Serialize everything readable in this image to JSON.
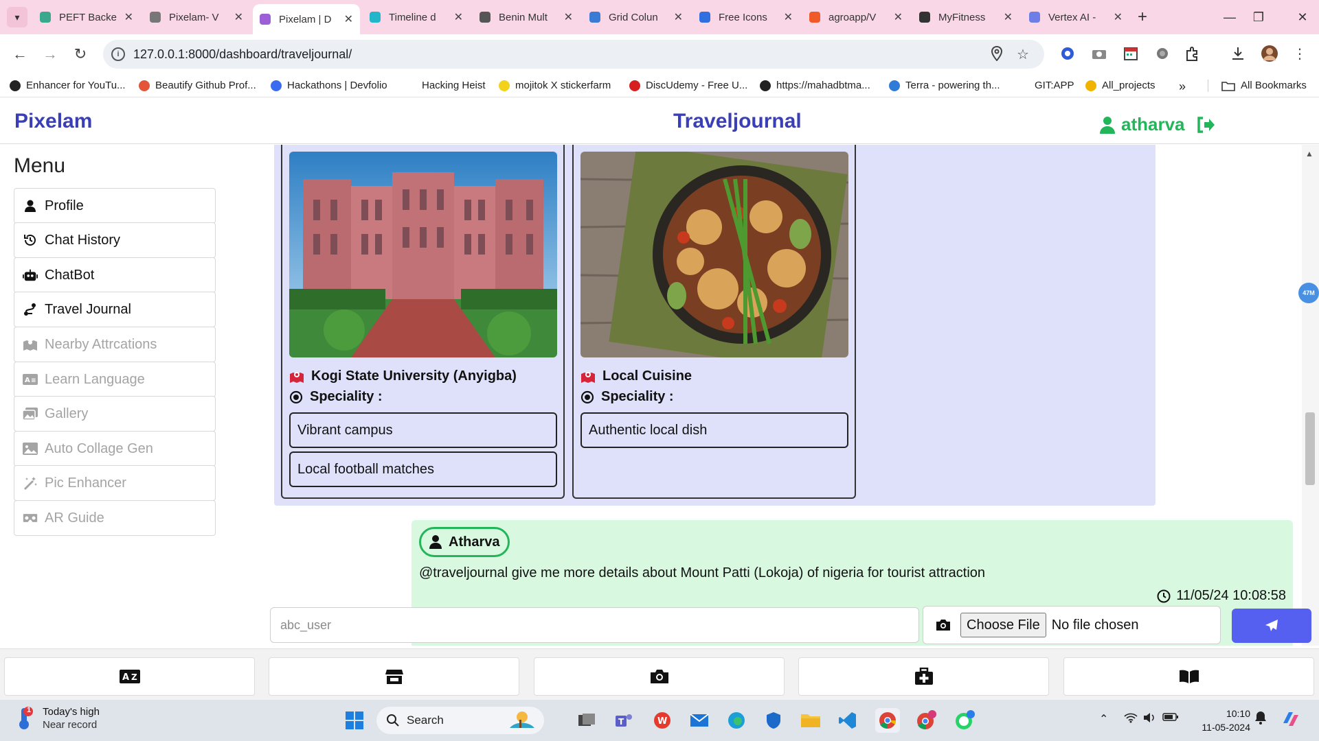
{
  "browser": {
    "tabs": [
      {
        "label": "PEFT Backe",
        "color": "#3aa88c"
      },
      {
        "label": "Pixelam- V",
        "color": "#777777"
      },
      {
        "label": "Pixelam | D",
        "color": "#9c5fd6"
      },
      {
        "label": "Timeline d",
        "color": "#23b5c9"
      },
      {
        "label": "Benin Mult",
        "color": "#555555"
      },
      {
        "label": "Grid Colun",
        "color": "#3a7bd5"
      },
      {
        "label": "Free Icons",
        "color": "#2f6fe0"
      },
      {
        "label": "agroapp/V",
        "color": "#f05a28"
      },
      {
        "label": "MyFitness",
        "color": "#333333"
      },
      {
        "label": "Vertex AI -",
        "color": "#6d7fe6"
      }
    ],
    "active_tab_index": 2,
    "url": "127.0.0.1:8000/dashboard/traveljournal/",
    "bookmarks": [
      {
        "label": "Enhancer for YouTu...",
        "color": "#222222"
      },
      {
        "label": "Beautify Github Prof...",
        "color": "#e2553a"
      },
      {
        "label": "Hackathons | Devfolio",
        "color": "#3b6cf0"
      },
      {
        "label": "Hacking Heist",
        "color": ""
      },
      {
        "label": "mojitok X stickerfarm",
        "color": "#f2d21b"
      },
      {
        "label": "DiscUdemy - Free U...",
        "color": "#d62020"
      },
      {
        "label": "https://mahadbtma...",
        "color": "#222222"
      },
      {
        "label": "Terra - powering th...",
        "color": "#2f7bd6"
      },
      {
        "label": "GIT:APP",
        "color": ""
      },
      {
        "label": "All_projects",
        "color": "#f0b400"
      }
    ],
    "all_bookmarks_label": "All Bookmarks"
  },
  "app": {
    "brand": "Pixelam",
    "page_title": "Traveljournal",
    "username": "atharva",
    "accent": "#3a3fb5",
    "user_color": "#22b55a"
  },
  "sidebar": {
    "title": "Menu",
    "items": [
      {
        "label": "Profile",
        "icon": "user-icon",
        "enabled": true
      },
      {
        "label": "Chat History",
        "icon": "history-icon",
        "enabled": true
      },
      {
        "label": "ChatBot",
        "icon": "robot-icon",
        "enabled": true
      },
      {
        "label": "Travel Journal",
        "icon": "route-icon",
        "enabled": true
      },
      {
        "label": "Nearby Attrcations",
        "icon": "map-icon",
        "enabled": false
      },
      {
        "label": "Learn Language",
        "icon": "language-icon",
        "enabled": false
      },
      {
        "label": "Gallery",
        "icon": "images-icon",
        "enabled": false
      },
      {
        "label": "Auto Collage Gen",
        "icon": "image-icon",
        "enabled": false
      },
      {
        "label": "Pic Enhancer",
        "icon": "magic-wand-icon",
        "enabled": false
      },
      {
        "label": "AR Guide",
        "icon": "vr-cardboard-icon",
        "enabled": false
      }
    ]
  },
  "chat": {
    "cards": [
      {
        "name": "Kogi State University (Anyigba)",
        "speciality_label": "Speciality :",
        "specialities": [
          "Vibrant campus",
          "Local football matches"
        ]
      },
      {
        "name": "Local Cuisine",
        "speciality_label": "Speciality :",
        "specialities": [
          "Authentic local dish"
        ]
      }
    ],
    "user_message": {
      "author": "Atharva",
      "text": "@traveljournal give me more details about Mount Patti (Lokoja) of nigeria for tourist attraction",
      "timestamp": "11/05/24 10:08:58"
    }
  },
  "composer": {
    "placeholder": "abc_user",
    "file_button": "Choose File",
    "file_status": "No file chosen"
  },
  "floating_badge": "47M",
  "bottom_nav": [
    "language-icon",
    "store-icon",
    "camera-icon",
    "medkit-icon",
    "book-open-icon"
  ],
  "taskbar": {
    "weather_title": "Today's high",
    "weather_sub": "Near record",
    "weather_badge": "1",
    "search_label": "Search",
    "time": "10:10",
    "date": "11-05-2024"
  }
}
